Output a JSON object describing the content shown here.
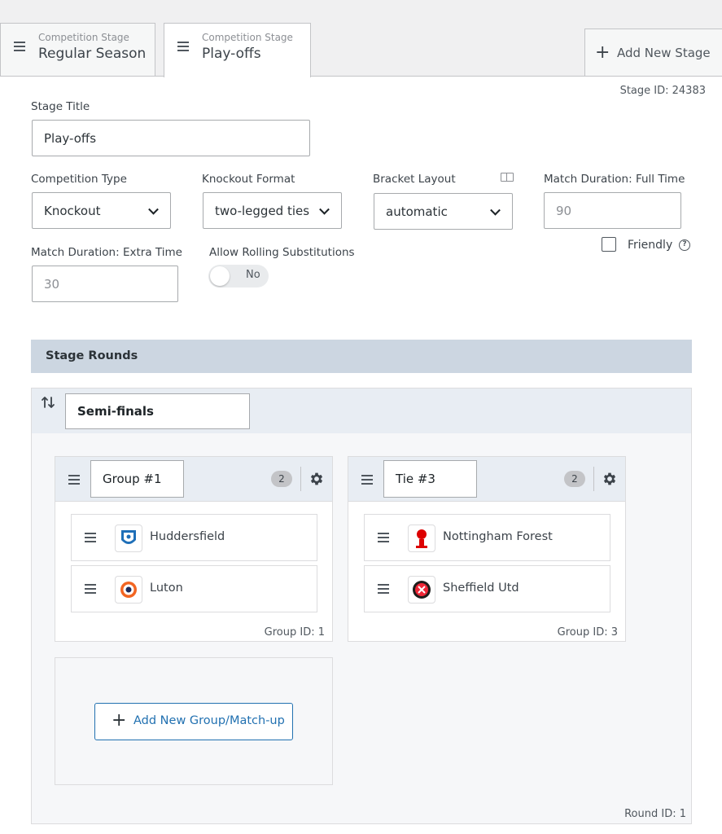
{
  "tabs": [
    {
      "kicker": "Competition Stage",
      "name": "Regular Season",
      "active": false
    },
    {
      "kicker": "Competition Stage",
      "name": "Play-offs",
      "active": true
    }
  ],
  "add_stage_label": "Add New Stage",
  "stage_id_text": "Stage ID: 24383",
  "form": {
    "stage_title": {
      "label": "Stage Title",
      "value": "Play-offs"
    },
    "competition_type": {
      "label": "Competition Type",
      "value": "Knockout"
    },
    "knockout_format": {
      "label": "Knockout Format",
      "value": "two-legged ties"
    },
    "bracket_layout": {
      "label": "Bracket Layout",
      "value": "automatic"
    },
    "duration_full": {
      "label": "Match Duration: Full Time",
      "placeholder": "90"
    },
    "duration_extra": {
      "label": "Match Duration: Extra Time",
      "placeholder": "30"
    },
    "friendly": {
      "label": "Friendly",
      "checked": false
    },
    "rolling_subs": {
      "label": "Allow Rolling Substitutions",
      "value": "No"
    }
  },
  "rounds_header": "Stage Rounds",
  "round": {
    "name": "Semi-finals",
    "id_text": "Round ID: 1",
    "groups": [
      {
        "name": "Group #1",
        "count": "2",
        "id_text": "Group ID: 1",
        "teams": [
          {
            "name": "Huddersfield",
            "crest_color": "#1e6fb8"
          },
          {
            "name": "Luton",
            "crest_color": "#f26522"
          }
        ]
      },
      {
        "name": "Tie #3",
        "count": "2",
        "id_text": "Group ID: 3",
        "teams": [
          {
            "name": "Nottingham Forest",
            "crest_color": "#dd0000"
          },
          {
            "name": "Sheffield Utd",
            "crest_color": "#ee2737"
          }
        ]
      }
    ],
    "add_group_label": "Add New Group/Match-up"
  }
}
